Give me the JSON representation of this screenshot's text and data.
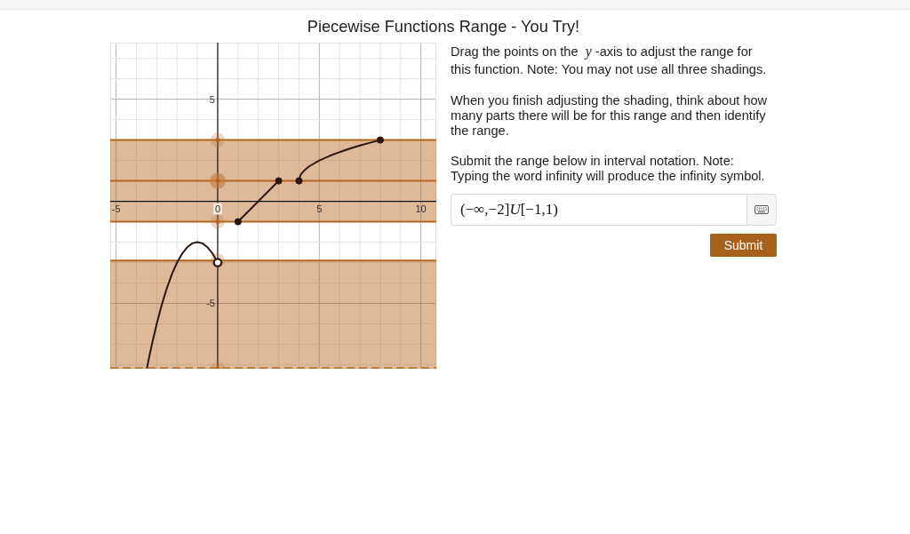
{
  "header": {
    "title": "Piecewise Functions Range - You Try!"
  },
  "graph": {
    "chart_data": {
      "type": "line",
      "xlim": [
        -5.29,
        10.76
      ],
      "ylim": [
        -8.2,
        7.77
      ],
      "xticks": [
        -5,
        0,
        5,
        10
      ],
      "yticks": [
        -5,
        5
      ],
      "grid": true,
      "series": [
        {
          "x": [
            -3.48,
            -3.25,
            -3,
            -2.75,
            -2.5,
            -2.25,
            -2,
            -1.75,
            -1.5,
            -1.25,
            -1,
            -0.75,
            -0.5,
            -0.25,
            0
          ],
          "values": [
            -8.15,
            -7.06,
            -6,
            -5.06,
            -4.25,
            -3.56,
            -3,
            -2.56,
            -2.25,
            -2.06,
            -2,
            -2.06,
            -2.25,
            -2.56,
            -3
          ]
        },
        {
          "x": [
            1,
            3
          ],
          "values": [
            -1,
            1
          ],
          "marker": "circle"
        },
        {
          "x": [
            4,
            4.02,
            4.1,
            4.25,
            4.5,
            5,
            5.5,
            6,
            6.5,
            7,
            7.5,
            8
          ],
          "values": [
            1,
            1.14,
            1.32,
            1.5,
            1.71,
            2,
            2.22,
            2.41,
            2.58,
            2.73,
            2.87,
            3
          ]
        },
        {
          "x": [
            4
          ],
          "values": [
            1
          ],
          "marker": "circle"
        },
        {
          "x": [
            8
          ],
          "values": [
            3
          ],
          "marker": "circle"
        },
        {
          "x": [
            0
          ],
          "values": [
            -3
          ],
          "marker": "circle"
        }
      ],
      "bands": [
        {
          "axis": "y",
          "from": 1,
          "to": 3
        },
        {
          "axis": "y",
          "from": -1,
          "to": 1
        },
        {
          "axis": "y",
          "from": -8.2,
          "to": -2.9
        }
      ],
      "ref_lines": [
        {
          "axis": "y",
          "value": 3
        },
        {
          "axis": "y",
          "value": 1
        },
        {
          "axis": "y",
          "value": -1
        },
        {
          "axis": "y",
          "value": -2.9
        },
        {
          "axis": "y",
          "value": -8.2
        }
      ]
    },
    "endpoints": [
      {
        "open": false
      },
      {
        "open": false
      },
      {
        "open": false
      },
      {
        "open": false
      },
      {
        "open": true
      }
    ]
  },
  "instructions": [
    "Drag the points on the *y*-axis to adjust the range for this function. Note: You may not use all three shadings.",
    "When you finish adjusting the shading, think about how many parts there will be for this range and then identify the range.",
    "Submit the range below in interval notation. Note: Typing the word infinity will produce the infinity symbol."
  ],
  "answer": {
    "value": "(−∞,−2]*U*[−1,1)"
  },
  "submit_button": {
    "label": "Submit"
  }
}
